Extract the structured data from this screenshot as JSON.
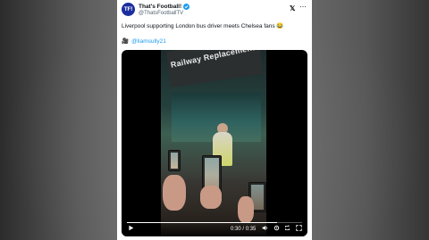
{
  "tweet": {
    "account_name": "That's Football!",
    "avatar_text": "TF!",
    "handle": "@ThatsFootballTV",
    "text": "Liverpool supporting London bus driver meets Chelsea fans 😂",
    "credit_emoji": "🎥",
    "credit_handle": "@liamsully21"
  },
  "video": {
    "sign_text": "Railway Replacement",
    "current_time": "0:30",
    "separator": "/",
    "duration": "0:35",
    "progress": 0.857
  },
  "icons": {
    "play": "play-icon",
    "volume": "volume-icon",
    "settings": "settings-icon",
    "repost": "repost-icon",
    "fullscreen": "fullscreen-icon",
    "more": "more-icon",
    "x_logo": "x-logo-icon",
    "verified": "verified-badge-icon"
  },
  "colors": {
    "avatar": "#1b2d9e",
    "verified": "#1d9bf0",
    "link": "#1d9bf0"
  }
}
